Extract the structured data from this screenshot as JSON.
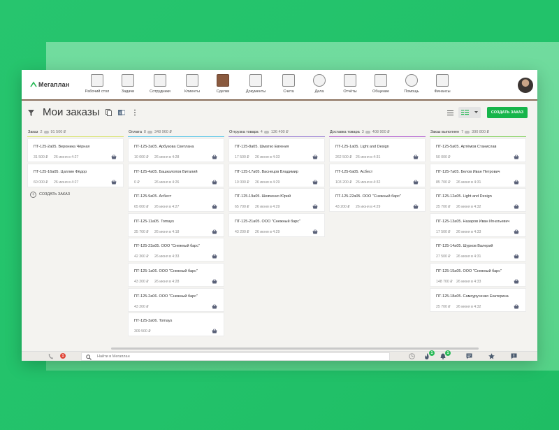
{
  "app": {
    "logo_text": "Мегаплан"
  },
  "nav": [
    {
      "label": "Рабочий стол",
      "icon": "desktop-icon"
    },
    {
      "label": "Задачи",
      "icon": "tasks-icon"
    },
    {
      "label": "Сотрудники",
      "icon": "employees-icon"
    },
    {
      "label": "Клиенты",
      "icon": "clients-icon"
    },
    {
      "label": "Сделки",
      "icon": "deals-icon",
      "active": true
    },
    {
      "label": "Документы",
      "icon": "documents-icon"
    },
    {
      "label": "Счета",
      "icon": "invoices-icon"
    },
    {
      "label": "Дела",
      "icon": "clock-icon"
    },
    {
      "label": "Отчёты",
      "icon": "reports-icon"
    },
    {
      "label": "Общение",
      "icon": "chat-icon"
    },
    {
      "label": "Помощь",
      "icon": "help-icon"
    },
    {
      "label": "Финансы",
      "icon": "finance-icon"
    }
  ],
  "toolbar": {
    "title": "Мои заказы",
    "create_label": "СОЗДАТЬ ЗАКАЗ"
  },
  "columns": [
    {
      "name": "Заказ",
      "count": "2",
      "sum": "91 500 ₽",
      "color": "#d7e26a",
      "cards": [
        {
          "title": "ПТ-125-2а05. Вероника Чёрная",
          "price": "31 500 ₽",
          "date": "26 июня в 4:27"
        },
        {
          "title": "ПТ-125-16а05. Цаплин Фёдор",
          "price": "60 000 ₽",
          "date": "26 июня в 4:27"
        }
      ],
      "add_label": "СОЗДАТЬ ЗАКАЗ"
    },
    {
      "name": "Оплата",
      "count": "8",
      "sum": "348 960 ₽",
      "color": "#4fc3e8",
      "cards": [
        {
          "title": "ПТ-125-3а05. Арбузова Светлана",
          "price": "10 000 ₽",
          "date": "26 июня в 4:28"
        },
        {
          "title": "ПТ-125-4а05. Башкалопов Виталий",
          "price": "0 ₽",
          "date": "26 июня в 4:26"
        },
        {
          "title": "ПТ-125-9а05. Асбест",
          "price": "65 000 ₽",
          "date": "26 июня в 4:27"
        },
        {
          "title": "ПТ-125-11а05. Tomays",
          "price": "35 700 ₽",
          "date": "26 июня в 4:18"
        },
        {
          "title": "ПТ-125-23а05. ООО \"Снежный барс\"",
          "price": "42 360 ₽",
          "date": "26 июня в 4:33"
        },
        {
          "title": "ПТ-125-1а06. ООО \"Снежный барс\"",
          "price": "43 200 ₽",
          "date": "26 июня в 4:28"
        },
        {
          "title": "ПТ-125-2а06. ООО \"Снежный барс\"",
          "price": "43 200 ₽",
          "date": ""
        },
        {
          "title": "ПТ-125-3а06. Tomays",
          "price": "309 500 ₽",
          "date": ""
        }
      ]
    },
    {
      "name": "Отгрузка товара",
      "count": "4",
      "sum": "136 400 ₽",
      "color": "#9a7fd4",
      "cards": [
        {
          "title": "ПТ-125-8а05. Шматко Евгения",
          "price": "17 500 ₽",
          "date": "26 июня в 4:33"
        },
        {
          "title": "ПТ-125-17а05. Васнецов Владимир",
          "price": "10 000 ₽",
          "date": "26 июня в 4:29"
        },
        {
          "title": "ПТ-125-19а05. Шевченко Юрий",
          "price": "65 700 ₽",
          "date": "26 июня в 4:29"
        },
        {
          "title": "ПТ-125-21а05. ООО \"Снежный барс\"",
          "price": "43 200 ₽",
          "date": "26 июня в 4:29"
        }
      ]
    },
    {
      "name": "Доставка товара",
      "count": "3",
      "sum": "408 900 ₽",
      "color": "#b05fd0",
      "cards": [
        {
          "title": "ПТ-125-1а05. Light and Design",
          "price": "262 500 ₽",
          "date": "26 июня в 4:31"
        },
        {
          "title": "ПТ-125-6а05. Асбест",
          "price": "103 200 ₽",
          "date": "26 июня в 4:32"
        },
        {
          "title": "ПТ-125-22а05. ООО \"Снежный барс\"",
          "price": "43 200 ₽",
          "date": "26 июня в 4:29"
        }
      ]
    },
    {
      "name": "Заказ выполнен",
      "count": "7",
      "sum": "390 800 ₽",
      "color": "#7fcf5a",
      "cards": [
        {
          "title": "ПТ-125-5а05. Артёмов Станислав",
          "price": "50 000 ₽",
          "date": ""
        },
        {
          "title": "ПТ-125-7а05. Белов Иван Петрович",
          "price": "85 700 ₽",
          "date": "26 июня в 4:31"
        },
        {
          "title": "ПТ-125-12а05. Light and Design",
          "price": "25 700 ₽",
          "date": "26 июня в 4:32"
        },
        {
          "title": "ПТ-125-13а05. Назаров Иван Игнатьевич",
          "price": "17 500 ₽",
          "date": "26 июня в 4:33"
        },
        {
          "title": "ПТ-125-14а05. Шурков Валерий",
          "price": "27 500 ₽",
          "date": "26 июня в 4:31"
        },
        {
          "title": "ПТ-125-15а05. ООО \"Снежный барс\"",
          "price": "148 700 ₽",
          "date": "26 июня в 4:33"
        },
        {
          "title": "ПТ-125-18а05. Самоурученко Екатерина",
          "price": "25 700 ₽",
          "date": "26 июня в 4:32"
        }
      ]
    }
  ],
  "bottombar": {
    "search_placeholder": "Найти в Мегаплан",
    "missed_calls": "1",
    "notif_a": "1",
    "notif_b": "1"
  },
  "colors": {
    "accent_green": "#17b54b",
    "nav_border": "#8a6f5c"
  }
}
